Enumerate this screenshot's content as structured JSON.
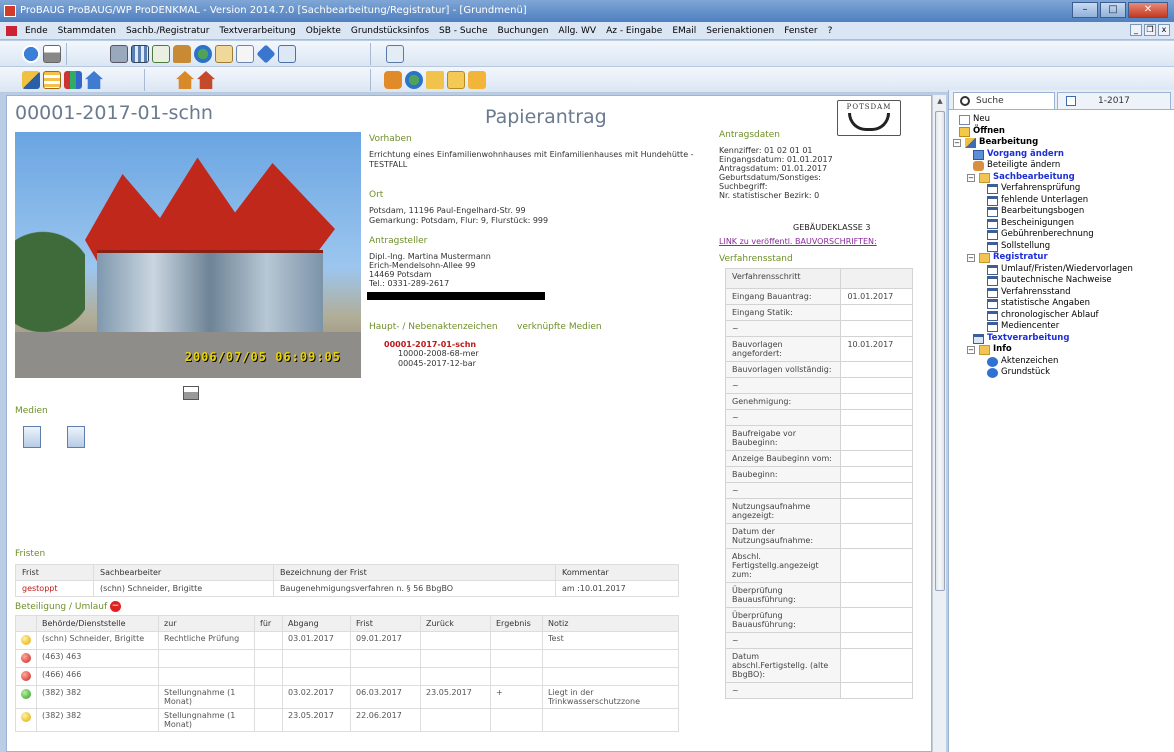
{
  "window": {
    "title": "ProBAUG ProBAUG/WP ProDENKMAL - Version 2014.7.0 [Sachbearbeitung/Registratur] - [Grundmenü]",
    "minimize": "–",
    "maximize": "□",
    "close": "✕"
  },
  "menu": [
    "Ende",
    "Stammdaten",
    "Sachb./Registratur",
    "Textverarbeitung",
    "Objekte",
    "Grundstücksinfos",
    "SB - Suche",
    "Buchungen",
    "Allg. WV",
    "Az - Eingabe",
    "EMail",
    "Serienaktionen",
    "Fenster",
    "?"
  ],
  "mdi": {
    "min": "_",
    "restore": "❐",
    "close": "x"
  },
  "doc": {
    "title": "00001-2017-01-schn",
    "type": "Papierantrag",
    "logo_text": "POTSDAM",
    "photo_stamp": "2006/07/05 06:09:05",
    "vorhaben_label": "Vorhaben",
    "vorhaben_text": "Errichtung eines Einfamilienwohnhauses mit Einfamilienhauses mit Hundehütte - TESTFALL",
    "ort_label": "Ort",
    "ort_line1": "Potsdam, 11196 Paul-Engelhard-Str. 99",
    "ort_line2": "Gemarkung: Potsdam, Flur: 9, Flurstück: 999",
    "antragsteller_label": "Antragsteller",
    "antragsteller_lines": [
      "Dipl.-Ing. Martina Mustermann",
      "Erich-Mendelsohn-Allee 99",
      "14469 Potsdam",
      "Tel.: 0331-289-2617"
    ],
    "aktenz_label": "Haupt- / Nebenaktenzeichen",
    "medien_link_label": "verknüpfte Medien",
    "aktenz_main": "00001-2017-01-schn",
    "aktenz_sub": [
      "10000-2008-68-mer",
      "00045-2017-12-bar"
    ],
    "medien_label": "Medien",
    "antragsdaten_label": "Antragsdaten",
    "antragsdaten_lines": [
      "Kennziffer: 01 02 01 01",
      "Eingangsdatum: 01.01.2017",
      "Antragsdatum: 01.01.2017",
      "Geburtsdatum/Sonstiges:",
      "Suchbegriff:",
      "Nr. statistischer Bezirk: 0"
    ],
    "gebaeudeklasse": "GEBÄUDEKLASSE 3",
    "link_bauvorschriften": "LINK zu veröffentl. BAUVORSCHRIFTEN:",
    "verfahrensstand_label": "Verfahrensstand",
    "verfahren_header": "Verfahrensschritt",
    "verfahren_rows": [
      {
        "label": "Eingang Bauantrag:",
        "value": "01.01.2017"
      },
      {
        "label": "Eingang Statik:",
        "value": ""
      },
      {
        "label": "~",
        "value": ""
      },
      {
        "label": "Bauvorlagen angefordert:",
        "value": "10.01.2017"
      },
      {
        "label": "Bauvorlagen vollständig:",
        "value": ""
      },
      {
        "label": "~",
        "value": ""
      },
      {
        "label": "Genehmigung:",
        "value": ""
      },
      {
        "label": "~",
        "value": ""
      },
      {
        "label": "Baufreigabe vor Baubeginn:",
        "value": ""
      },
      {
        "label": "Anzeige Baubeginn vom:",
        "value": ""
      },
      {
        "label": "Baubeginn:",
        "value": ""
      },
      {
        "label": "~",
        "value": ""
      },
      {
        "label": "Nutzungsaufnahme angezeigt:",
        "value": ""
      },
      {
        "label": "Datum der Nutzungsaufnahme:",
        "value": ""
      },
      {
        "label": "Abschl. Fertigstellg.angezeigt zum:",
        "value": ""
      },
      {
        "label": "Überprüfung Bauausführung:",
        "value": ""
      },
      {
        "label": "Überprüfung Bauausführung:",
        "value": ""
      },
      {
        "label": "~",
        "value": ""
      },
      {
        "label": "Datum abschl.Fertigstellg. (alte BbgBO):",
        "value": ""
      },
      {
        "label": "~",
        "value": ""
      }
    ],
    "fristen_label": "Fristen",
    "fristen_headers": [
      "Frist",
      "Sachbearbeiter",
      "Bezeichnung der Frist",
      "Kommentar"
    ],
    "fristen_rows": [
      [
        "gestoppt",
        "(schn) Schneider, Brigitte",
        "Baugenehmigungsverfahren n. § 56 BbgBO",
        "am :10.01.2017"
      ]
    ],
    "beteiligung_label": "Beteiligung / Umlauf",
    "beteiligung_headers": [
      "",
      "Behörde/Dienststelle",
      "zur",
      "für",
      "Abgang",
      "Frist",
      "Zurück",
      "Ergebnis",
      "Notiz"
    ],
    "beteiligung_rows": [
      {
        "status": "yellow",
        "cells": [
          "(schn) Schneider, Brigitte",
          "Rechtliche Prüfung",
          "",
          "03.01.2017",
          "09.01.2017",
          "",
          "",
          "Test"
        ]
      },
      {
        "status": "red",
        "cells": [
          "(463) 463",
          "",
          "",
          "",
          "",
          "",
          "",
          ""
        ]
      },
      {
        "status": "red",
        "cells": [
          "(466) 466",
          "",
          "",
          "",
          "",
          "",
          "",
          ""
        ]
      },
      {
        "status": "green",
        "cells": [
          "(382) 382",
          "Stellungnahme (1 Monat)",
          "",
          "03.02.2017",
          "06.03.2017",
          "23.05.2017",
          "+",
          "Liegt in der Trinkwasserschutzzone"
        ]
      },
      {
        "status": "yellow",
        "cells": [
          "(382) 382",
          "Stellungnahme (1 Monat)",
          "",
          "23.05.2017",
          "22.06.2017",
          "",
          "",
          ""
        ]
      }
    ]
  },
  "right_panel": {
    "tab_search": "Suche",
    "tab_case": "1-2017",
    "tree": [
      {
        "label": "Neu",
        "level": 0,
        "icon": "page",
        "style": "normal"
      },
      {
        "label": "Öffnen",
        "level": 0,
        "icon": "folderopen",
        "style": "bold"
      },
      {
        "label": "Bearbeitung",
        "level": 0,
        "icon": "pen",
        "style": "bold",
        "expander": "−"
      },
      {
        "label": "Vorgang ändern",
        "level": 1,
        "icon": "editdoc",
        "style": "blue"
      },
      {
        "label": "Beteiligte ändern",
        "level": 1,
        "icon": "people",
        "style": "normal"
      },
      {
        "label": "Sachbearbeitung",
        "level": 1,
        "icon": "folderblue",
        "style": "blue",
        "expander": "−"
      },
      {
        "label": "Verfahrensprüfung",
        "level": 2,
        "icon": "win",
        "style": "normal"
      },
      {
        "label": "fehlende Unterlagen",
        "level": 2,
        "icon": "win",
        "style": "normal"
      },
      {
        "label": "Bearbeitungsbogen",
        "level": 2,
        "icon": "win",
        "style": "normal"
      },
      {
        "label": "Bescheinigungen",
        "level": 2,
        "icon": "win",
        "style": "normal"
      },
      {
        "label": "Gebührenberechnung",
        "level": 2,
        "icon": "win",
        "style": "normal"
      },
      {
        "label": "Sollstellung",
        "level": 2,
        "icon": "win",
        "style": "normal"
      },
      {
        "label": "Registratur",
        "level": 1,
        "icon": "folderblue",
        "style": "blue",
        "expander": "−"
      },
      {
        "label": "Umlauf/Fristen/Wiedervorlagen",
        "level": 2,
        "icon": "win",
        "style": "normal"
      },
      {
        "label": "bautechnische Nachweise",
        "level": 2,
        "icon": "win",
        "style": "normal"
      },
      {
        "label": "Verfahrensstand",
        "level": 2,
        "icon": "win",
        "style": "normal"
      },
      {
        "label": "statistische Angaben",
        "level": 2,
        "icon": "win",
        "style": "normal"
      },
      {
        "label": "chronologischer Ablauf",
        "level": 2,
        "icon": "win",
        "style": "normal"
      },
      {
        "label": "Mediencenter",
        "level": 2,
        "icon": "win",
        "style": "normal"
      },
      {
        "label": "Textverarbeitung",
        "level": 1,
        "icon": "textv",
        "style": "blue"
      },
      {
        "label": "Info",
        "level": 1,
        "icon": "folderblue",
        "style": "bold",
        "expander": "−"
      },
      {
        "label": "Aktenzeichen",
        "level": 2,
        "icon": "info",
        "style": "normal"
      },
      {
        "label": "Grundstück",
        "level": 2,
        "icon": "info",
        "style": "normal"
      }
    ]
  }
}
